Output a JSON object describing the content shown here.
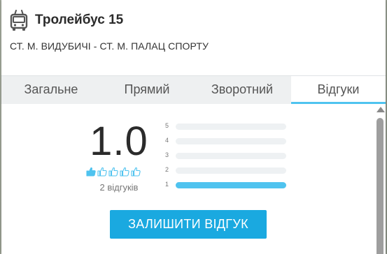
{
  "header": {
    "title": "Тролейбус 15",
    "route": "СТ. М. ВИДУБИЧІ - СТ. М. ПАЛАЦ СПОРТУ",
    "icon": "trolleybus-icon"
  },
  "tabs": [
    {
      "label": "Загальне",
      "active": false
    },
    {
      "label": "Прямий",
      "active": false
    },
    {
      "label": "Зворотний",
      "active": false
    },
    {
      "label": "Відгуки",
      "active": true
    }
  ],
  "reviews": {
    "rating": "1.0",
    "thumbs_filled": 1,
    "thumbs_total": 5,
    "count_label": "2 відгуків",
    "distribution": [
      {
        "label": "5",
        "fraction": 0
      },
      {
        "label": "4",
        "fraction": 0
      },
      {
        "label": "3",
        "fraction": 0
      },
      {
        "label": "2",
        "fraction": 0
      },
      {
        "label": "1",
        "fraction": 1
      }
    ],
    "button_label": "ЗАЛИШИТИ ВІДГУК"
  },
  "colors": {
    "accent": "#4fc3ef",
    "button": "#1aa9e0"
  }
}
